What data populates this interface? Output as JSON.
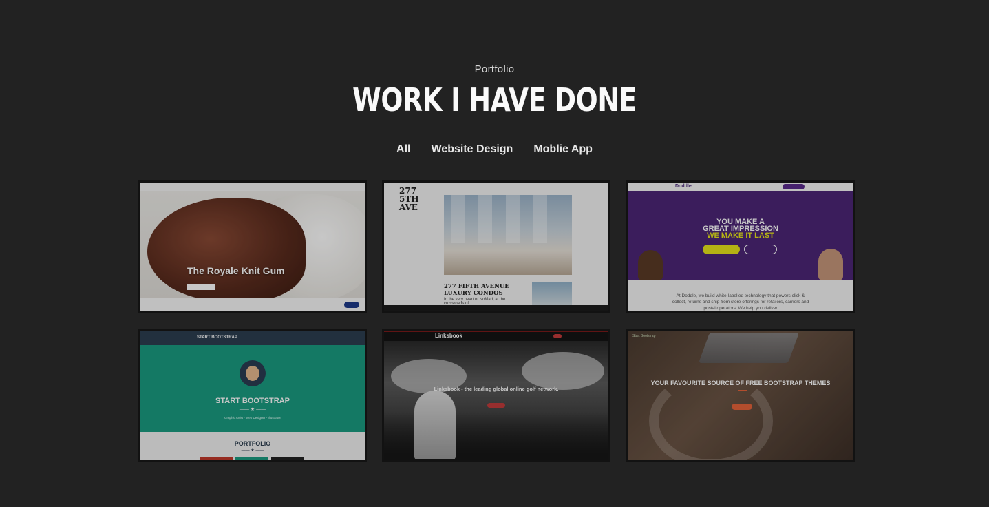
{
  "header": {
    "eyebrow": "Portfolio",
    "title": "WORK I HAVE DONE"
  },
  "filters": [
    {
      "label": "All"
    },
    {
      "label": "Website Design"
    },
    {
      "label": "Moblie App"
    }
  ],
  "portfolio": {
    "items": [
      {
        "heading": "The Royale Knit Gum"
      },
      {
        "logo": "277 5TH AVE",
        "heading": "277 FIFTH AVENUE LUXURY CONDOS",
        "sub": "In the very heart of NoMad, at the crossroads of"
      },
      {
        "brand": "Doddle",
        "heading_line1": "YOU MAKE A",
        "heading_line2": "GREAT IMPRESSION",
        "heading_line3": "WE MAKE IT LAST",
        "body": "At Doddle, we build white-labelled technology that powers click & collect, returns and ship from store offerings for retailers, carriers and postal operators. We help you deliver"
      },
      {
        "brand": "START BOOTSTRAP",
        "heading": "START BOOTSTRAP",
        "tagline": "Graphic Artist - Web Designer - Illustrator",
        "section": "PORTFOLIO"
      },
      {
        "brand": "Linksbook",
        "heading": "Linksbook - the leading global online golf network."
      },
      {
        "brand": "Start Bootstrap",
        "heading": "YOUR FAVOURITE SOURCE OF FREE BOOTSTRAP THEMES"
      }
    ]
  },
  "colors": {
    "background": "#222222",
    "doddle_purple": "#4c2677",
    "doddle_yellow": "#e7e51a",
    "bootstrap_teal": "#1a9c80",
    "bootstrap_navy": "#2c3e50",
    "accent_orange": "#e6633a"
  }
}
